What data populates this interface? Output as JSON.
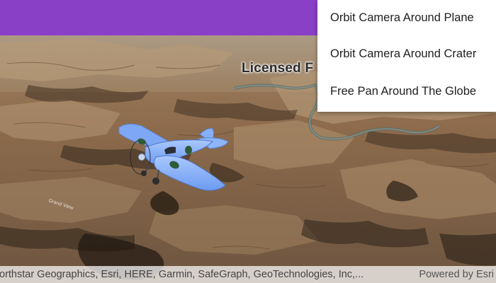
{
  "appbar": {
    "color": "#8a3fc7"
  },
  "menu": {
    "items": [
      {
        "label": "Orbit Camera Around Plane"
      },
      {
        "label": "Orbit Camera Around Crater"
      },
      {
        "label": "Free Pan Around The Globe"
      }
    ]
  },
  "map": {
    "label_text": "Licensed F",
    "road_label": "Grand View"
  },
  "attribution": {
    "text": "orthstar Geographics, Esri, HERE, Garmin, SafeGraph, GeoTechnologies, Inc,...",
    "powered_by": "Powered by Esri"
  }
}
